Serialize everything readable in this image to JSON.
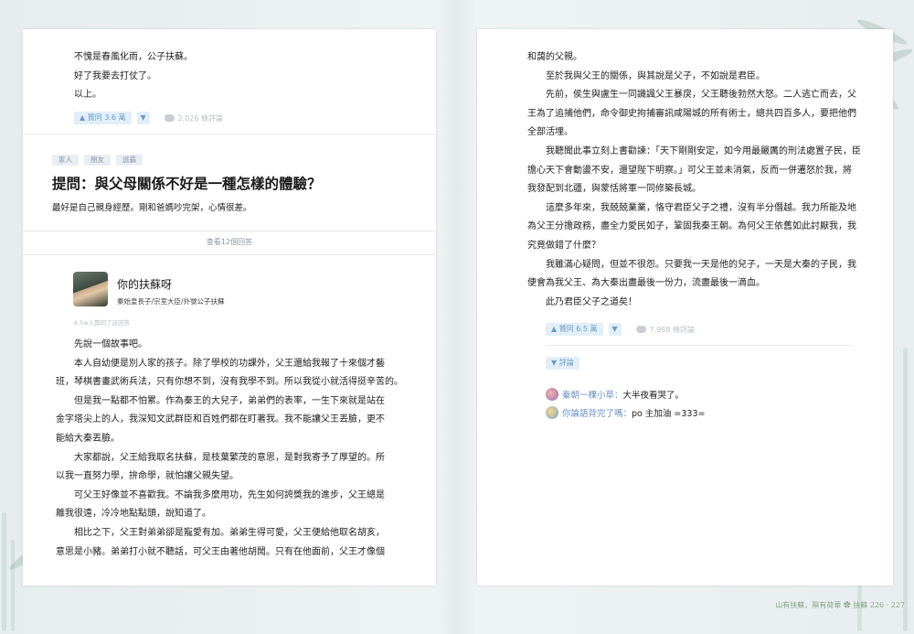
{
  "left_page": {
    "prev_answer": {
      "lines": [
        "不愧是春風化雨，公子扶蘇。",
        "好了我要去打仗了。",
        "以上。"
      ],
      "upvote": "▲ 贊同 3.6 萬",
      "down": "▼",
      "comments": "2,026 條評論"
    },
    "question": {
      "tags": [
        "家人",
        "朋友",
        "逃霸"
      ],
      "title": "提問：與父母關係不好是一種怎樣的體驗？",
      "desc": "最好是自己親身經歷。剛和爸媽吵完架，心情很差。"
    },
    "view_answers": "查看12個回答",
    "answer": {
      "author": "你的扶蘇呀",
      "author_desc": "秦始皇長子/宗室大臣/外號公子扶蘇",
      "agree_note": "6.5w人贊同了該回答",
      "paragraphs": [
        {
          "indent": true,
          "text": "先說一個故事吧。"
        },
        {
          "indent": true,
          "text": "本人自幼便是別人家的孩子。除了學校的功課外，父王還給我報了十來個才藝"
        },
        {
          "indent": false,
          "text": "班，琴棋書畫武術兵法，只有你想不到，沒有我學不到。所以我從小就活得挺辛苦的。"
        },
        {
          "indent": true,
          "text": "但是我一點都不怕累。作為秦王的大兒子，弟弟們的表率，一生下來就是站在"
        },
        {
          "indent": false,
          "text": "金字塔尖上的人，我深知文武群臣和百姓們都在盯著我。我不能讓父王丟臉，更不"
        },
        {
          "indent": false,
          "text": "能給大秦丟臉。"
        },
        {
          "indent": true,
          "text": "大家都說，父王給我取名扶蘇，是枝葉繁茂的意思，是對我寄予了厚望的。所"
        },
        {
          "indent": false,
          "text": "以我一直努力學，拚命學，就怕讓父親失望。"
        },
        {
          "indent": true,
          "text": "可父王好像並不喜歡我。不論我多麼用功，先生如何誇獎我的進步，父王總是"
        },
        {
          "indent": false,
          "text": "離我很遠，冷冷地點點頭，說知道了。"
        },
        {
          "indent": true,
          "text": "相比之下，父王對弟弟卻是寵愛有加。弟弟生得可愛，父王便給他取名胡亥，"
        },
        {
          "indent": false,
          "text": "意思是小豬。弟弟打小就不聽話，可父王由著他胡鬧。只有在他面前，父王才像個"
        }
      ]
    }
  },
  "right_page": {
    "paragraphs": [
      {
        "indent": false,
        "text": "和藹的父親。"
      },
      {
        "indent": true,
        "text": "至於我與父王的關係，與其說是父子，不如說是君臣。"
      },
      {
        "indent": true,
        "text": "先前，侯生與盧生一同譏諷父王暴戾，父王聽後勃然大怒。二人逃亡而去，父"
      },
      {
        "indent": false,
        "text": "王為了追捕他們，命令御史拘捕審訊咸陽城的所有術士，總共四百多人，要把他們"
      },
      {
        "indent": false,
        "text": "全部活埋。"
      },
      {
        "indent": true,
        "text": "我聽聞此事立刻上書勸諫：「天下剛剛安定，如今用最嚴厲的刑法處置子民，臣"
      },
      {
        "indent": false,
        "text": "擔心天下會動盪不安，還望陛下明察。」可父王並未消氣，反而一併遷怒於我，將"
      },
      {
        "indent": false,
        "text": "我發配到北疆，與蒙恬將軍一同修築長城。"
      },
      {
        "indent": true,
        "text": "這麼多年來，我兢兢業業，恪守君臣父子之禮，沒有半分僭越。我力所能及地"
      },
      {
        "indent": false,
        "text": "為父王分擔政務，盡全力愛民如子，鞏固我秦王朝。為何父王依舊如此討厭我，我"
      },
      {
        "indent": false,
        "text": "究竟做錯了什麼？"
      },
      {
        "indent": true,
        "text": "我雖滿心疑問，但並不很怨。只要我一天是他的兒子，一天是大秦的子民，我"
      },
      {
        "indent": false,
        "text": "便會為我父王、為大秦出盡最後一份力，流盡最後一滴血。"
      },
      {
        "indent": true,
        "text": "此乃君臣父子之道矣！"
      }
    ],
    "upvote": "▲ 贊同 6.5 萬",
    "down": "▼",
    "comments": "7,988 條評論",
    "comments_toggle": "▼ 評論",
    "comment_list": [
      {
        "user": "秦朝一棵小草：",
        "text": "大半夜看哭了。"
      },
      {
        "user": "你論語背完了嗎：",
        "text": "po 主加油 =333="
      }
    ],
    "footer": "山有扶蘇，隰有荷華 ✿ 扶蘇   226 · 227"
  },
  "colors": {
    "accent": "#6b9cc7",
    "user": "#6a90c0",
    "footer": "#8aa38a"
  }
}
